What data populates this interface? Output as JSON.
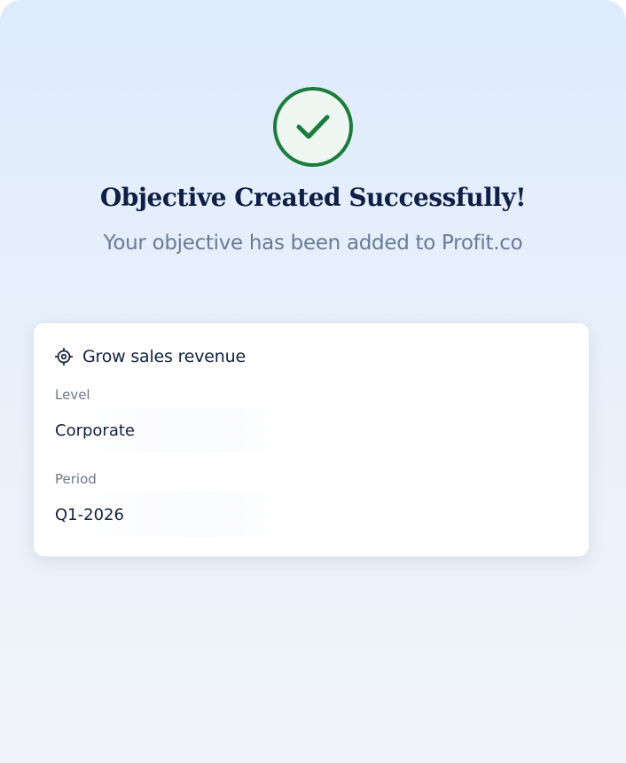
{
  "success": {
    "icon": "check-circle-icon",
    "title": "Objective Created Successfully!",
    "subtitle": "Your objective has been added to Profit.co",
    "accent_color": "#1c7c3d"
  },
  "objective_card": {
    "icon": "target-icon",
    "title": "Grow sales revenue",
    "fields": [
      {
        "label": "Level",
        "value": "Corporate"
      },
      {
        "label": "Period",
        "value": "Q1-2026"
      }
    ]
  }
}
